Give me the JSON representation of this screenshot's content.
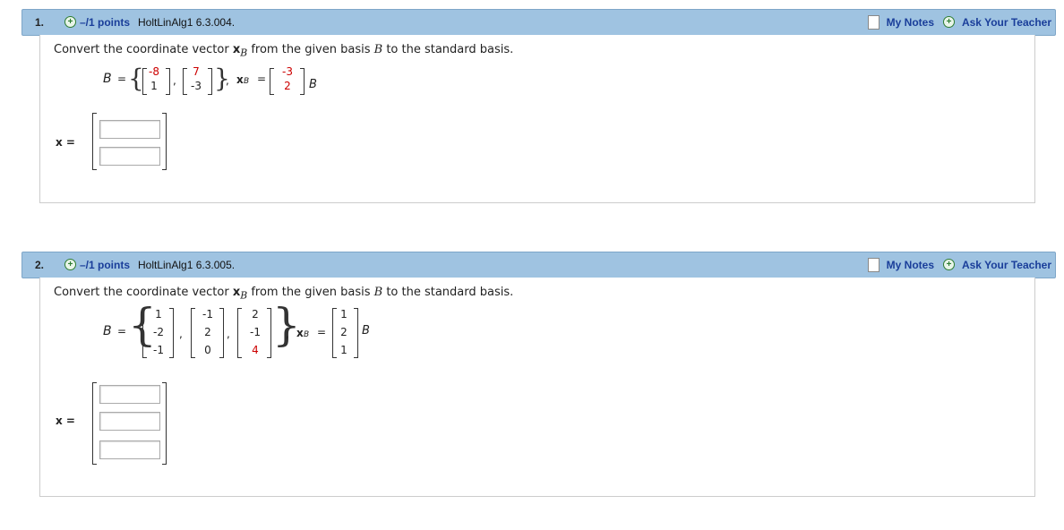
{
  "questions": [
    {
      "number": "1.",
      "points": "–/1 points",
      "code": "HoltLinAlg1 6.3.004.",
      "my_notes": "My Notes",
      "ask_teacher": "Ask Your Teacher",
      "prompt_a": "Convert the coordinate vector ",
      "prompt_x": "x",
      "prompt_sub": "B",
      "prompt_b": " from the given basis ",
      "prompt_basis": "B",
      "prompt_c": " to the standard basis.",
      "basis_label": "B",
      "xb_label": "x",
      "basis_vectors": [
        [
          "-8",
          "1"
        ],
        [
          "7",
          "-3"
        ]
      ],
      "xb_values": [
        "-3",
        "2"
      ],
      "answer_label": "x ="
    },
    {
      "number": "2.",
      "points": "–/1 points",
      "code": "HoltLinAlg1 6.3.005.",
      "my_notes": "My Notes",
      "ask_teacher": "Ask Your Teacher",
      "prompt_a": "Convert the coordinate vector ",
      "prompt_x": "x",
      "prompt_sub": "B",
      "prompt_b": " from the given basis ",
      "prompt_basis": "B",
      "prompt_c": " to the standard basis.",
      "basis_label": "B",
      "xb_label": "x",
      "basis_vectors": [
        [
          "1",
          "-2",
          "-1"
        ],
        [
          "-1",
          "2",
          "0"
        ],
        [
          "2",
          "-1",
          "4"
        ]
      ],
      "xb_values": [
        "1",
        "2",
        "1"
      ],
      "answer_label": "x ="
    }
  ],
  "colors": {
    "header_bg": "#9fc3e1",
    "link": "#1a3e9a",
    "red_entry": "#cc0000",
    "plus_green": "#2e7d32"
  },
  "icons": [
    "plus-circle-icon",
    "notes-icon"
  ]
}
